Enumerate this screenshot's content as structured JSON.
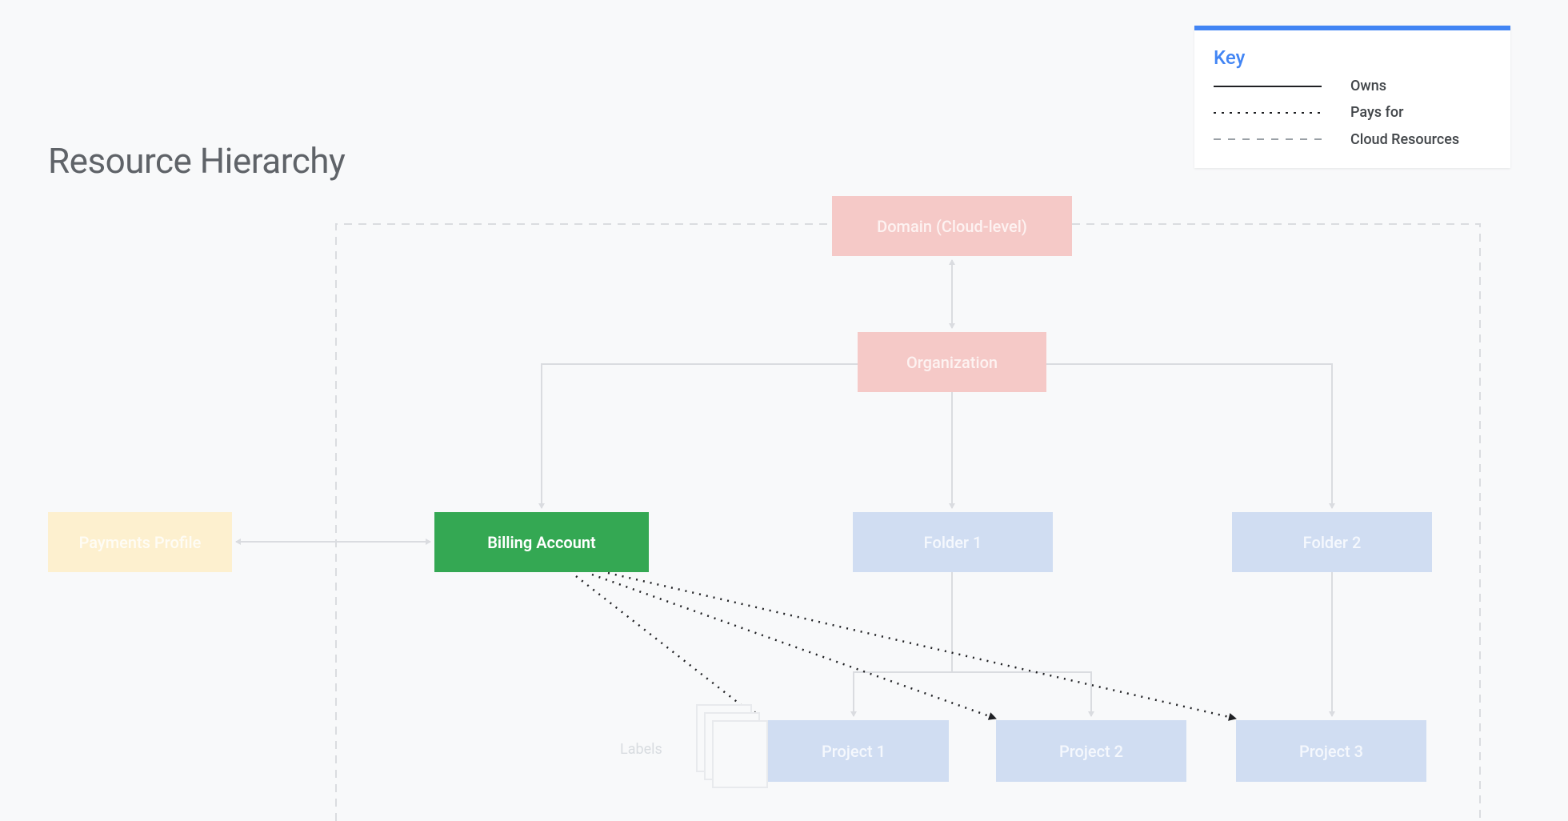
{
  "title": "Resource Hierarchy",
  "nodes": {
    "domain": "Domain (Cloud-level)",
    "organization": "Organization",
    "payments_profile": "Payments Profile",
    "billing_account": "Billing Account",
    "folder1": "Folder 1",
    "folder2": "Folder 2",
    "project1": "Project 1",
    "project2": "Project 2",
    "project3": "Project 3",
    "labels": "Labels"
  },
  "legend": {
    "title": "Key",
    "owns": "Owns",
    "pays_for": "Pays for",
    "cloud_resources": "Cloud Resources"
  },
  "colors": {
    "highlight_green": "#34a853",
    "faded_red": "#f5c9c7",
    "faded_blue": "#d0ddf2",
    "faded_yellow": "#fdf0cf",
    "accent_blue": "#4285f4",
    "line_faded": "#dadce0",
    "line_dark": "#202124"
  }
}
